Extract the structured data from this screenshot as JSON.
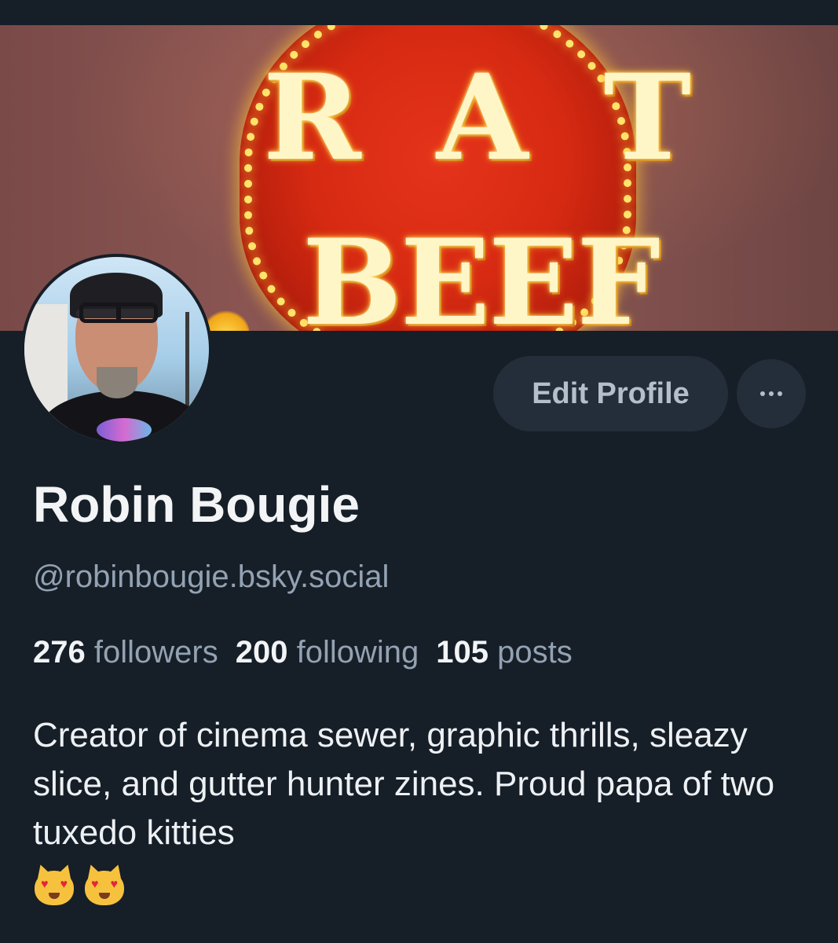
{
  "banner": {
    "sign_line1": "R A T",
    "sign_line2": "BEEF"
  },
  "profile": {
    "display_name": "Robin Bougie",
    "handle": "@robinbougie.bsky.social",
    "followers_count": "276",
    "followers_label": "followers",
    "following_count": "200",
    "following_label": "following",
    "posts_count": "105",
    "posts_label": "posts",
    "bio": "Creator of cinema sewer, graphic thrills, sleazy slice, and gutter hunter zines. Proud papa of two tuxedo kitties",
    "bio_emojis": [
      "smiling-cat-heart-eyes-emoji",
      "smiling-cat-heart-eyes-emoji"
    ]
  },
  "actions": {
    "edit_label": "Edit Profile",
    "more_icon": "more-horizontal-icon"
  },
  "colors": {
    "background": "#161e27",
    "button_bg": "#242e3a",
    "text_primary": "#f2f4f6",
    "text_secondary": "#93a2b3"
  }
}
